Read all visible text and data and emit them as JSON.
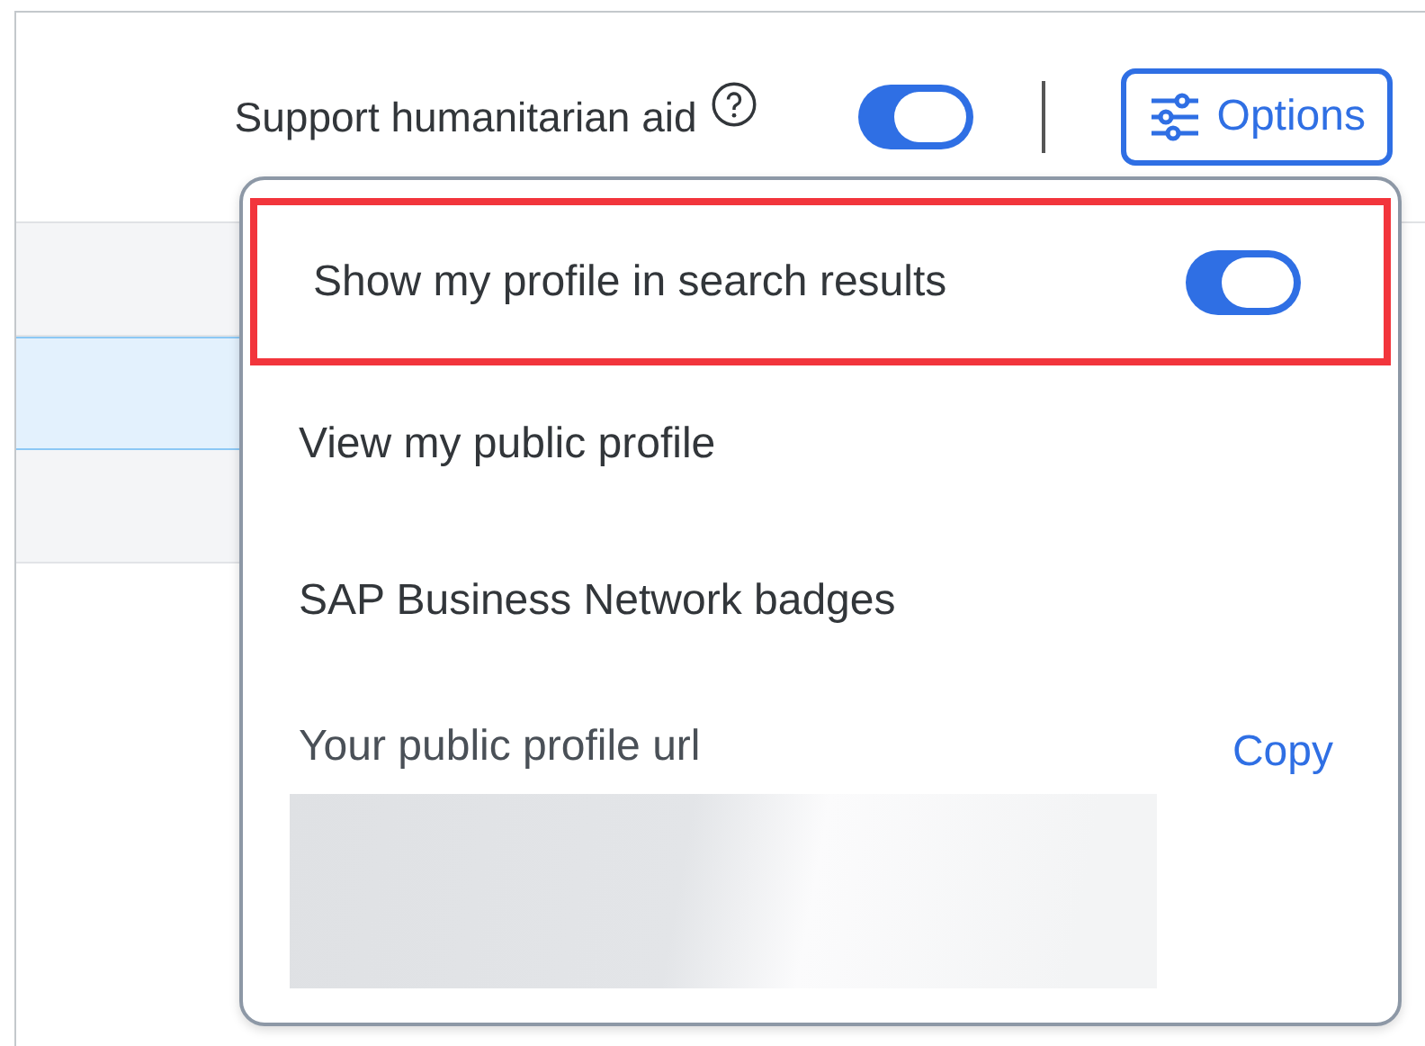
{
  "header": {
    "label": "Support humanitarian aid",
    "toggle_on": true,
    "options_button": "Options"
  },
  "rows": [
    {
      "selected": false
    },
    {
      "selected": true
    },
    {
      "selected": false
    }
  ],
  "menu": {
    "items": [
      {
        "kind": "toggle",
        "label": "Show my profile in search results",
        "on": true,
        "highlighted": true
      },
      {
        "kind": "link",
        "label": "View my public profile"
      },
      {
        "kind": "link",
        "label": "SAP Business Network badges"
      },
      {
        "kind": "url",
        "label": "Your public profile url",
        "action": "Copy",
        "blurred": true
      }
    ]
  }
}
